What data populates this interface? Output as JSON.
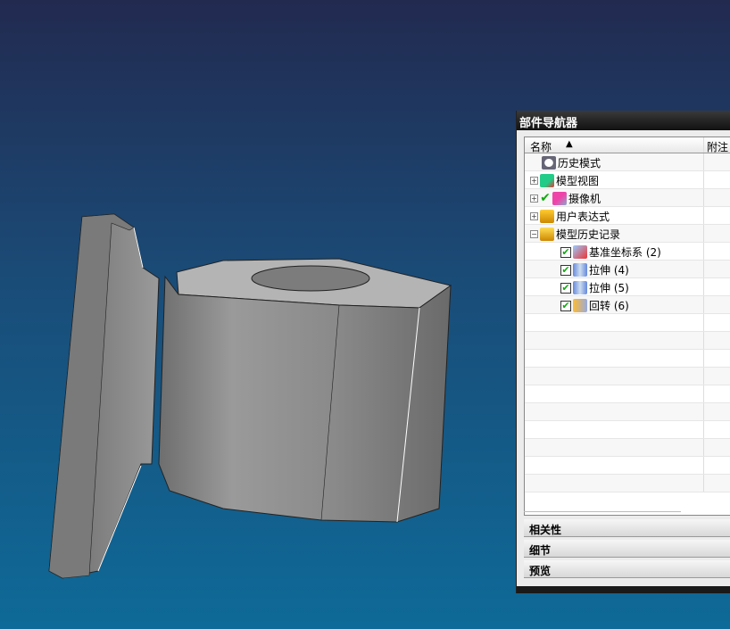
{
  "navigator": {
    "title": "部件导航器",
    "columns": {
      "name": "名称",
      "sort_indicator": "▲",
      "note": "附注"
    },
    "rows": [
      {
        "label": "历史模式",
        "icon": "clock-icon",
        "expander": ""
      },
      {
        "label": "模型视图",
        "icon": "model-view-icon",
        "expander": "+"
      },
      {
        "label": "摄像机",
        "icon": "camera-icon",
        "expander": "+",
        "checked": true
      },
      {
        "label": "用户表达式",
        "icon": "folder-icon",
        "expander": "+"
      },
      {
        "label": "模型历史记录",
        "icon": "folder-open-icon",
        "expander": "−"
      },
      {
        "label": "基准坐标系 (2)",
        "icon": "datum-csys-icon",
        "checked": true
      },
      {
        "label": "拉伸 (4)",
        "icon": "extrude-icon",
        "checked": true
      },
      {
        "label": "拉伸 (5)",
        "icon": "extrude-icon",
        "checked": true
      },
      {
        "label": "回转 (6)",
        "icon": "revolve-icon",
        "checked": true
      }
    ],
    "sections": [
      "相关性",
      "细节",
      "预览"
    ]
  },
  "colors": {
    "bg_top": "#222a50",
    "bg_bottom": "#0e6a98",
    "check": "#1aaa1a"
  }
}
